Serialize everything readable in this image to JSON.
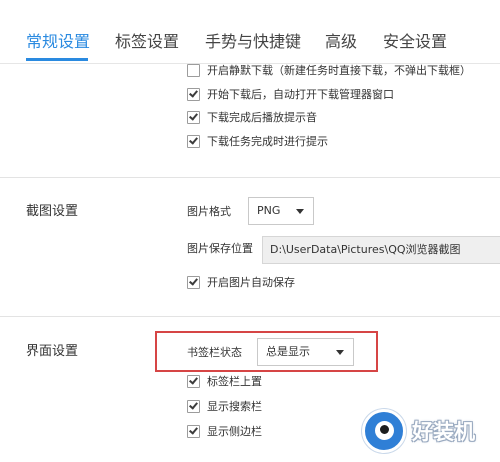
{
  "tabs": [
    {
      "label": "常规设置",
      "active": true
    },
    {
      "label": "标签设置",
      "active": false
    },
    {
      "label": "手势与快捷键",
      "active": false
    },
    {
      "label": "高级",
      "active": false
    },
    {
      "label": "安全设置",
      "active": false
    }
  ],
  "download": {
    "options": [
      {
        "label": "开启静默下载（新建任务时直接下载，不弹出下载框）",
        "checked": false
      },
      {
        "label": "开始下载后，自动打开下载管理器窗口",
        "checked": true
      },
      {
        "label": "下载完成后播放提示音",
        "checked": true
      },
      {
        "label": "下载任务完成时进行提示",
        "checked": true
      }
    ]
  },
  "screenshot": {
    "title": "截图设置",
    "format_label": "图片格式",
    "format_value": "PNG",
    "path_label": "图片保存位置",
    "path_value": "D:\\UserData\\Pictures\\QQ浏览器截图",
    "autosave_label": "开启图片自动保存",
    "autosave_checked": true
  },
  "interface": {
    "title": "界面设置",
    "bookmark_bar_label": "书签栏状态",
    "bookmark_bar_value": "总是显示",
    "options": [
      {
        "label": "标签栏上置",
        "checked": true
      },
      {
        "label": "显示搜索栏",
        "checked": true
      },
      {
        "label": "显示侧边栏",
        "checked": true
      }
    ]
  },
  "watermark": {
    "text": "好装机"
  },
  "colors": {
    "accent": "#2a8ae0",
    "highlight": "#d64545"
  }
}
